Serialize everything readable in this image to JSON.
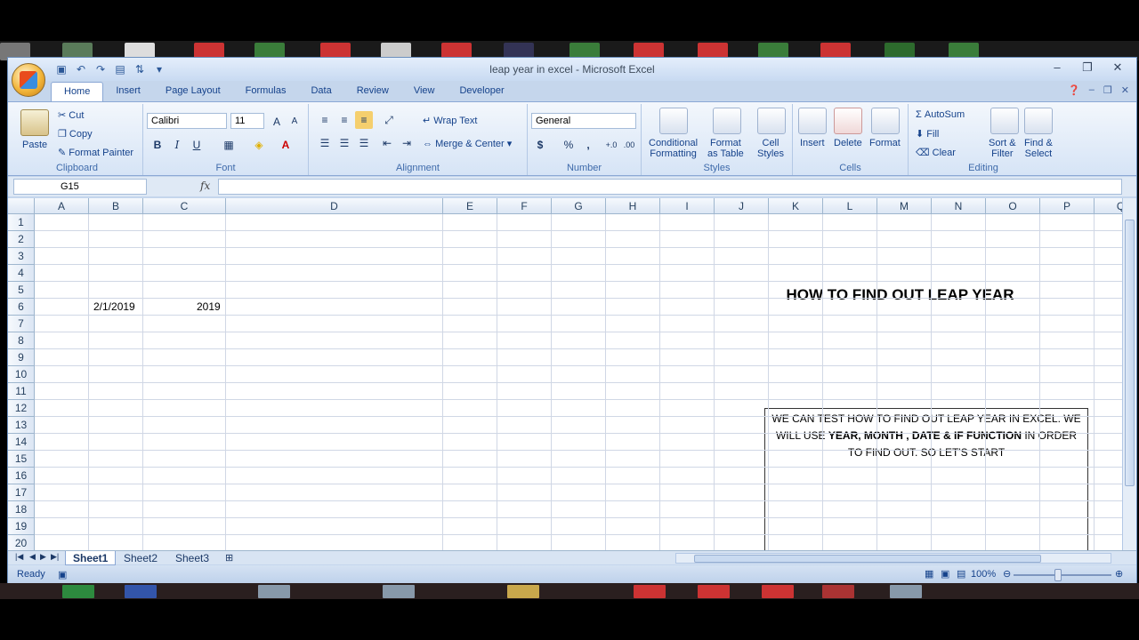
{
  "window": {
    "title": "leap year in excel - Microsoft Excel"
  },
  "tabs": [
    "Home",
    "Insert",
    "Page Layout",
    "Formulas",
    "Data",
    "Review",
    "View",
    "Developer"
  ],
  "ribbon": {
    "clipboard": {
      "paste": "Paste",
      "cut": "Cut",
      "copy": "Copy",
      "format_painter": "Format Painter",
      "label": "Clipboard"
    },
    "font": {
      "name": "Calibri",
      "size": "11",
      "bold": "B",
      "italic": "I",
      "underline": "U",
      "label": "Font"
    },
    "alignment": {
      "wrap": "Wrap Text",
      "merge": "Merge & Center",
      "label": "Alignment"
    },
    "number": {
      "format": "General",
      "currency": "$",
      "percent": "%",
      "comma": ",",
      "label": "Number"
    },
    "styles": {
      "conditional": "Conditional",
      "conditional2": "Formatting",
      "format_table": "Format",
      "format_table2": "as Table",
      "cell_styles": "Cell",
      "cell_styles2": "Styles",
      "label": "Styles"
    },
    "cells": {
      "insert": "Insert",
      "delete": "Delete",
      "format": "Format",
      "label": "Cells"
    },
    "editing": {
      "autosum": "AutoSum",
      "fill": "Fill",
      "clear": "Clear",
      "sort": "Sort &",
      "sort2": "Filter",
      "find": "Find &",
      "find2": "Select",
      "label": "Editing"
    }
  },
  "formula_bar": {
    "name_box": "G15",
    "fx": "fx",
    "value": ""
  },
  "columns": [
    "A",
    "B",
    "C",
    "D",
    "E",
    "F",
    "G",
    "H",
    "I",
    "J",
    "K",
    "L",
    "M",
    "N",
    "O",
    "P",
    "Q"
  ],
  "rows": [
    "1",
    "2",
    "3",
    "4",
    "5",
    "6",
    "7",
    "8",
    "9",
    "10",
    "11",
    "12",
    "13",
    "14",
    "15",
    "16",
    "17",
    "18",
    "19",
    "20"
  ],
  "cells": {
    "B3": "2/1/2019",
    "C3": "2019"
  },
  "heading": "HOW TO FIND OUT LEAP YEAR",
  "textbox": {
    "part1": "WE CAN TEST HOW TO FIND OUT LEAP YEAR IN EXCEL. WE WILL USE ",
    "bold": "YEAR, MONTH , DATE & IF FUNCTION",
    "part2": " IN ORDER TO FIND OUT. SO LET'S START"
  },
  "sheets": [
    "Sheet1",
    "Sheet2",
    "Sheet3"
  ],
  "status": {
    "ready": "Ready",
    "zoom": "100%"
  },
  "colors": {
    "accent": "#15428b",
    "ribbon": "#d6e4f6"
  }
}
